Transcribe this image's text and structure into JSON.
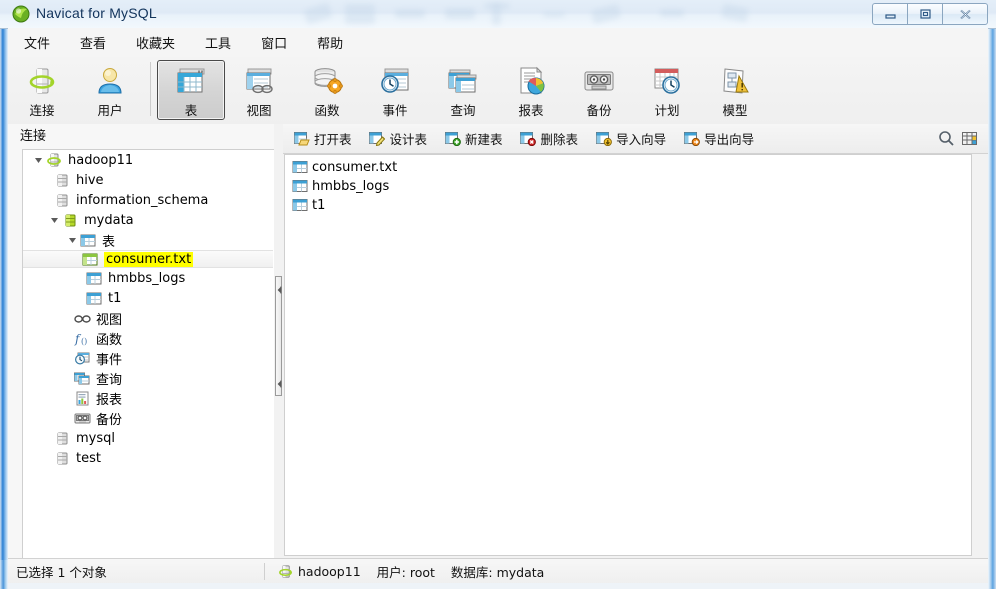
{
  "window": {
    "title": "Navicat for MySQL",
    "app_icon": "navicat-logo-icon",
    "controls": {
      "minimize": "minimize-icon",
      "maximize": "maximize-icon",
      "close": "close-icon"
    }
  },
  "menubar": {
    "items": [
      {
        "label": "文件",
        "name": "menu-file"
      },
      {
        "label": "查看",
        "name": "menu-view"
      },
      {
        "label": "收藏夹",
        "name": "menu-favorites"
      },
      {
        "label": "工具",
        "name": "menu-tools"
      },
      {
        "label": "窗口",
        "name": "menu-window"
      },
      {
        "label": "帮助",
        "name": "menu-help"
      }
    ]
  },
  "toolbar": {
    "buttons": [
      {
        "label": "连接",
        "icon": "connection-icon",
        "selected": false
      },
      {
        "label": "用户",
        "icon": "user-icon",
        "selected": false
      },
      {
        "label": "表",
        "icon": "table-icon",
        "selected": true
      },
      {
        "label": "视图",
        "icon": "view-icon",
        "selected": false
      },
      {
        "label": "函数",
        "icon": "function-icon",
        "selected": false
      },
      {
        "label": "事件",
        "icon": "event-icon",
        "selected": false
      },
      {
        "label": "查询",
        "icon": "query-icon",
        "selected": false
      },
      {
        "label": "报表",
        "icon": "report-icon",
        "selected": false
      },
      {
        "label": "备份",
        "icon": "backup-icon",
        "selected": false
      },
      {
        "label": "计划",
        "icon": "schedule-icon",
        "selected": false
      },
      {
        "label": "模型",
        "icon": "model-icon",
        "selected": false
      }
    ]
  },
  "sidebar": {
    "header": "连接",
    "tree": [
      {
        "label": "hadoop11",
        "icon": "server-connection-icon",
        "indent": 0,
        "twisty": "expanded",
        "selected": false
      },
      {
        "label": "hive",
        "icon": "database-gray-icon",
        "indent": 1,
        "twisty": "none",
        "selected": false
      },
      {
        "label": "information_schema",
        "icon": "database-gray-icon",
        "indent": 1,
        "twisty": "none",
        "selected": false
      },
      {
        "label": "mydata",
        "icon": "database-green-icon",
        "indent": 1,
        "twisty": "expanded",
        "selected": false
      },
      {
        "label": "表",
        "icon": "table-folder-icon",
        "indent": 2,
        "twisty": "expanded",
        "selected": false
      },
      {
        "label": "consumer.txt",
        "icon": "table-green-icon",
        "indent": 3,
        "twisty": "none",
        "selected": true,
        "highlight": true
      },
      {
        "label": "hmbbs_logs",
        "icon": "table-icon",
        "indent": 3,
        "twisty": "none",
        "selected": false
      },
      {
        "label": "t1",
        "icon": "table-icon",
        "indent": 3,
        "twisty": "none",
        "selected": false
      },
      {
        "label": "视图",
        "icon": "view-glasses-icon",
        "indent": 2,
        "twisty": "none",
        "selected": false
      },
      {
        "label": "函数",
        "icon": "function-fx-icon",
        "indent": 2,
        "twisty": "none",
        "selected": false
      },
      {
        "label": "事件",
        "icon": "event-clock-icon",
        "indent": 2,
        "twisty": "none",
        "selected": false
      },
      {
        "label": "查询",
        "icon": "query-icon",
        "indent": 2,
        "twisty": "none",
        "selected": false
      },
      {
        "label": "报表",
        "icon": "report-icon",
        "indent": 2,
        "twisty": "none",
        "selected": false
      },
      {
        "label": "备份",
        "icon": "backup-tape-icon",
        "indent": 2,
        "twisty": "none",
        "selected": false
      },
      {
        "label": "mysql",
        "icon": "database-gray-icon",
        "indent": 1,
        "twisty": "none",
        "selected": false
      },
      {
        "label": "test",
        "icon": "database-gray-icon",
        "indent": 1,
        "twisty": "none",
        "selected": false
      }
    ]
  },
  "content": {
    "objectbar": {
      "buttons": [
        {
          "label": "打开表",
          "icon": "open-table-icon"
        },
        {
          "label": "设计表",
          "icon": "design-table-icon"
        },
        {
          "label": "新建表",
          "icon": "new-table-icon"
        },
        {
          "label": "删除表",
          "icon": "delete-table-icon"
        },
        {
          "label": "导入向导",
          "icon": "import-wizard-icon"
        },
        {
          "label": "导出向导",
          "icon": "export-wizard-icon"
        }
      ],
      "right_icons": [
        {
          "name": "search-icon"
        },
        {
          "name": "grid-view-icon"
        }
      ]
    },
    "list": [
      {
        "label": "consumer.txt",
        "icon": "table-icon"
      },
      {
        "label": "hmbbs_logs",
        "icon": "table-icon"
      },
      {
        "label": "t1",
        "icon": "table-icon"
      }
    ]
  },
  "statusbar": {
    "selection": "已选择 1 个对象",
    "connection_icon": "server-connection-icon",
    "connection": "hadoop11",
    "user": "用户: root",
    "database": "数据库: mydata"
  },
  "colors": {
    "highlight_yellow": "#ffff00",
    "titlebar_blue": "#12345c",
    "accent_green": "#a8d22b",
    "table_blue": "#4aa8d8"
  }
}
